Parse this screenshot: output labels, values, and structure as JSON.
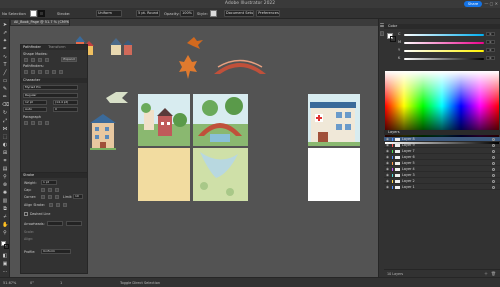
{
  "app": {
    "title": "Adobe Illustrator 2022",
    "share_label": "Share",
    "window_controls": "—  ▢  ✕"
  },
  "options_bar": {
    "selection": "No Selection",
    "stroke_label": "Stroke:",
    "stroke_profile": "Uniform",
    "brush": "5 pt. Round",
    "opacity_label": "Opacity:",
    "opacity_value": "100%",
    "style_label": "Style:",
    "doc_setup": "Document Setup",
    "preferences": "Preferences"
  },
  "document_tab": {
    "label": "All_Book_Page @ 51.7 % (CMYK/Preview)"
  },
  "properties_panel": {
    "tabs": [
      "Pathfinder",
      "Transform"
    ],
    "shape_modes_label": "Shape Modes:",
    "pathfinders_label": "Pathfinders:",
    "expand_label": "Expand",
    "character_label": "Character",
    "font_name": "Myriad Pro",
    "font_style": "Regular",
    "font_size": "12 pt",
    "leading": "(14.4 pt)",
    "tracking": "0",
    "kerning": "Auto",
    "paragraph_label": "Paragraph",
    "stroke_section": "Stroke",
    "weight_label": "Weight:",
    "weight_value": "1 pt",
    "cap_label": "Cap:",
    "corner_label": "Corner:",
    "limit_label": "Limit:",
    "limit_value": "10",
    "align_label": "Align Stroke:",
    "dashed_label": "Dashed Line",
    "arrowheads_label": "Arrowheads:",
    "scale_label": "Scale:",
    "align2_label": "Align:",
    "profile_label": "Profile:",
    "profile_value": "Uniform"
  },
  "color_panel": {
    "title": "Color",
    "channels": [
      {
        "label": "C",
        "value": "0"
      },
      {
        "label": "M",
        "value": "0"
      },
      {
        "label": "Y",
        "value": "0"
      },
      {
        "label": "K",
        "value": "0"
      }
    ],
    "channel_colors": [
      "#00aeef",
      "#ec008c",
      "#fff200",
      "#000000"
    ]
  },
  "layers_panel": {
    "title": "Layers",
    "items": [
      {
        "name": "Layer 8",
        "color": "#4f8cff",
        "selected": true
      },
      {
        "name": "Layer 9",
        "color": "#ff4f4f",
        "selected": false
      },
      {
        "name": "Layer 7",
        "color": "#4fd84f",
        "selected": false
      },
      {
        "name": "Layer 6",
        "color": "#4f8cff",
        "selected": false
      },
      {
        "name": "Layer 5",
        "color": "#ff9a4f",
        "selected": false
      },
      {
        "name": "Layer 4",
        "color": "#c44fff",
        "selected": false
      },
      {
        "name": "Layer 3",
        "color": "#4fd8d8",
        "selected": false
      },
      {
        "name": "Layer 2",
        "color": "#ffd84f",
        "selected": false
      },
      {
        "name": "Layer 1",
        "color": "#4f8cff",
        "selected": false
      }
    ],
    "footer_count": "10 Layers"
  },
  "status_bar": {
    "zoom": "51.67%",
    "angle": "0°",
    "artboard": "1",
    "tool_hint": "Toggle Direct Selection"
  },
  "canvas": {
    "background": "#535353",
    "artboard_color": "#ffffff"
  }
}
